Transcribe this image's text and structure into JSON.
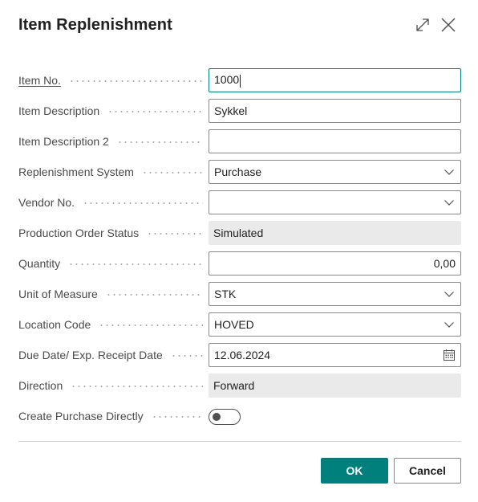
{
  "dialog": {
    "title": "Item Replenishment",
    "icons": {
      "expand": "expand-icon",
      "close": "close-icon"
    }
  },
  "fields": {
    "item_no": {
      "label": "Item No.",
      "value": "1000"
    },
    "item_description": {
      "label": "Item Description",
      "value": "Sykkel"
    },
    "item_description_2": {
      "label": "Item Description 2",
      "value": ""
    },
    "replenishment_system": {
      "label": "Replenishment System",
      "value": "Purchase"
    },
    "vendor_no": {
      "label": "Vendor No.",
      "value": ""
    },
    "production_order_status": {
      "label": "Production Order Status",
      "value": "Simulated"
    },
    "quantity": {
      "label": "Quantity",
      "value": "0,00"
    },
    "unit_of_measure": {
      "label": "Unit of Measure",
      "value": "STK"
    },
    "location_code": {
      "label": "Location Code",
      "value": "HOVED"
    },
    "due_date": {
      "label": "Due Date/ Exp. Receipt Date",
      "value": "12.06.2024"
    },
    "direction": {
      "label": "Direction",
      "value": "Forward"
    },
    "create_purchase_directly": {
      "label": "Create Purchase Directly",
      "value": "off"
    }
  },
  "buttons": {
    "ok": "OK",
    "cancel": "Cancel"
  },
  "colors": {
    "accent": "#00807d",
    "readonly_bg": "#eaeaea",
    "border": "#8a8a8a"
  }
}
